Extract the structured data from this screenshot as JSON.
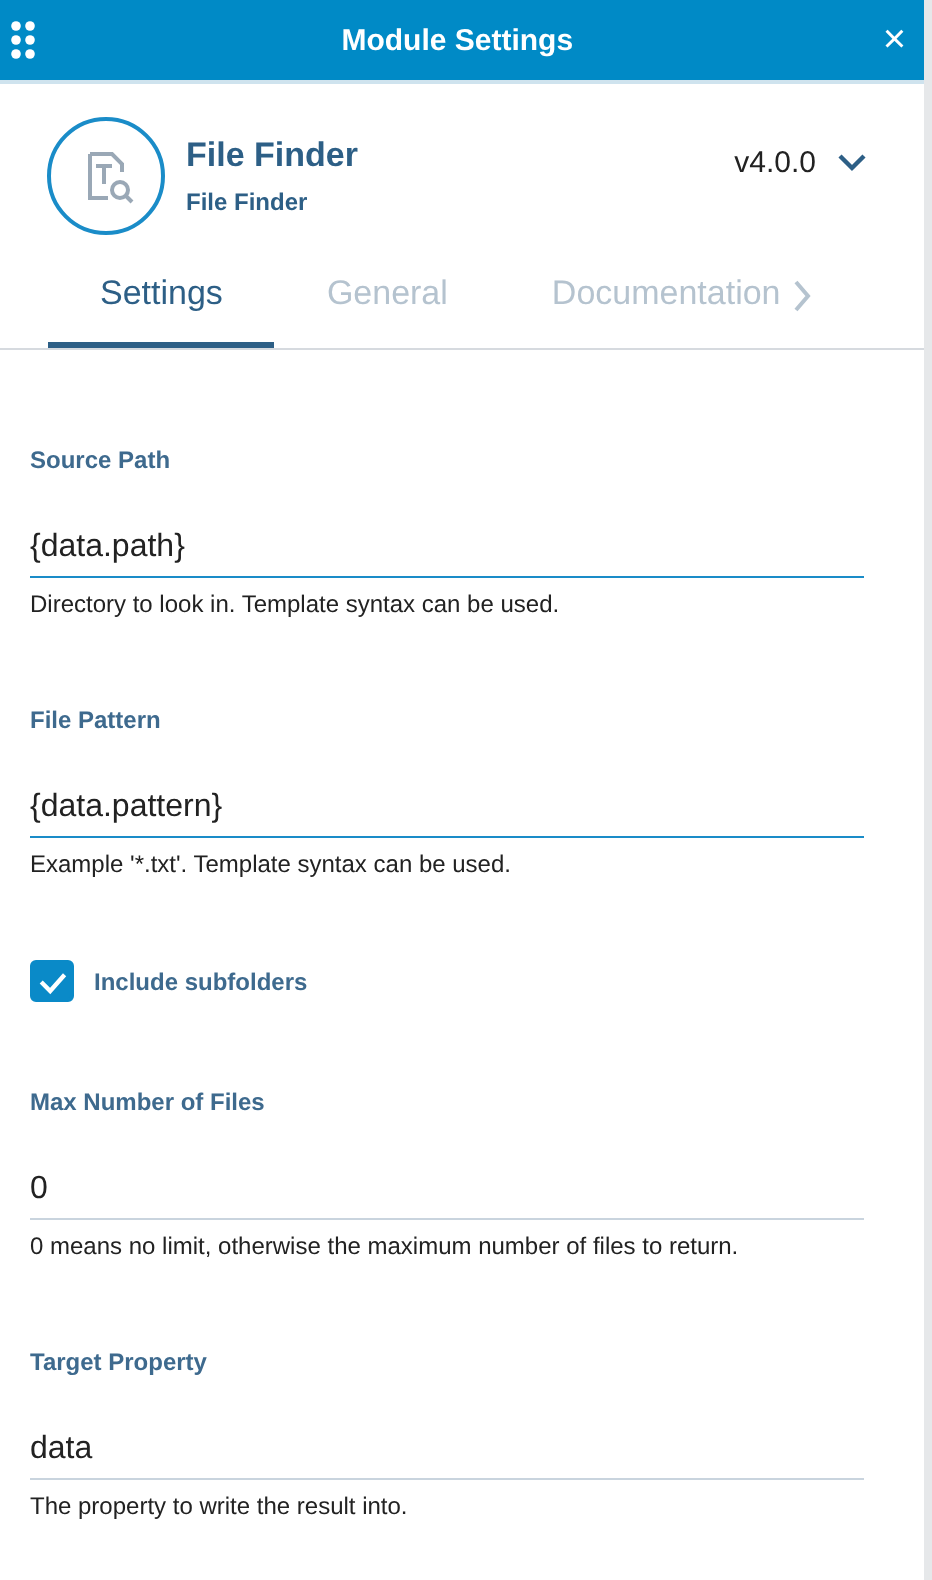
{
  "window": {
    "title": "Module Settings",
    "close": "×"
  },
  "module": {
    "name": "File Finder",
    "subtitle": "File Finder",
    "version": "v4.0.0"
  },
  "tabs": [
    {
      "label": "Settings",
      "selected": true
    },
    {
      "label": "General",
      "selected": false
    },
    {
      "label": "Documentation",
      "selected": false
    }
  ],
  "fields": [
    {
      "kind": "text",
      "label": "Source Path",
      "value": "{data.path}",
      "help": "Directory to look in. Template syntax can be used.",
      "active": true
    },
    {
      "kind": "text",
      "label": "File Pattern",
      "value": "{data.pattern}",
      "help": "Example '*.txt'. Template syntax can be used.",
      "active": true
    },
    {
      "kind": "checkbox",
      "label": "Include subfolders",
      "checked": true
    },
    {
      "kind": "text",
      "label": "Max Number of Files",
      "value": "0",
      "help": "0 means no limit, otherwise the maximum number of files to return.",
      "active": false
    },
    {
      "kind": "text",
      "label": "Target Property",
      "value": "data",
      "help": "The property to write the result into.",
      "active": false
    }
  ]
}
